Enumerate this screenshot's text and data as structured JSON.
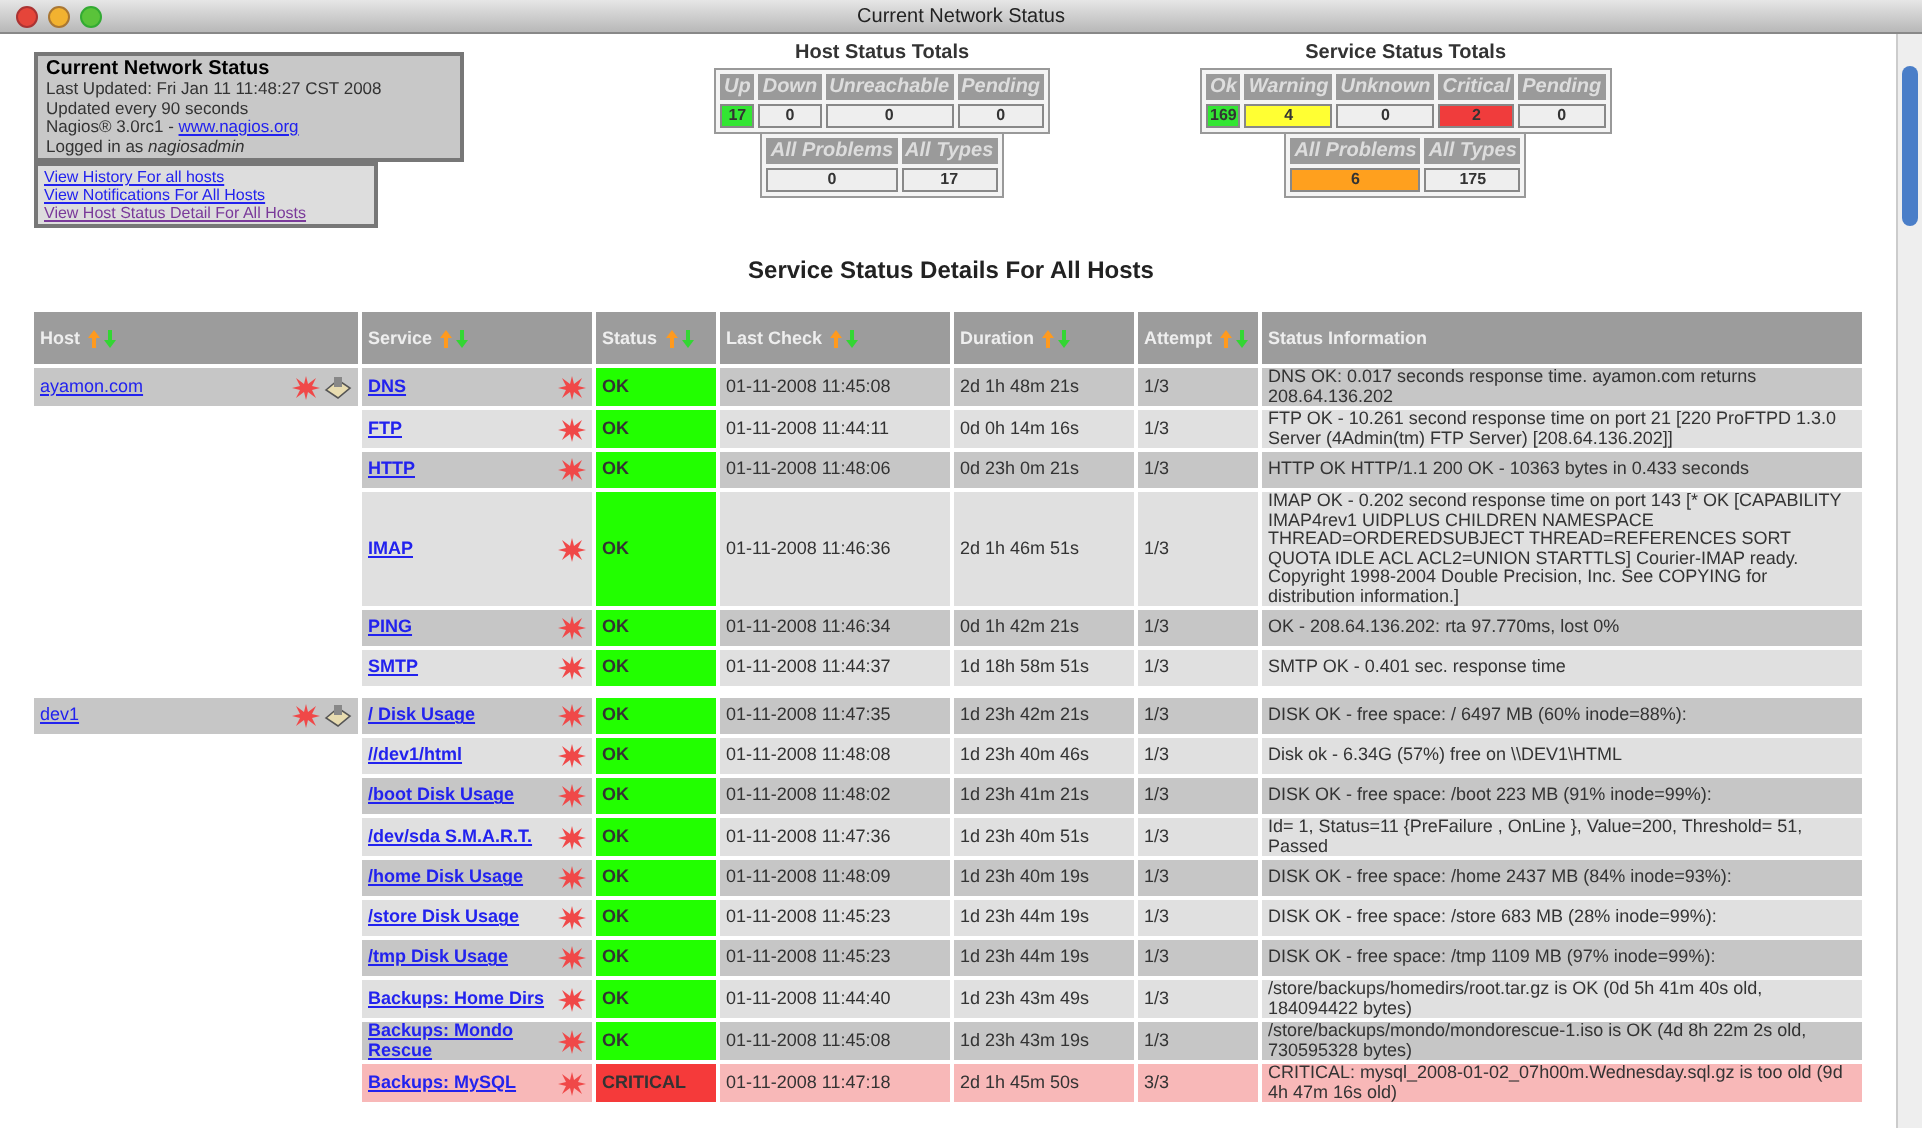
{
  "window": {
    "title": "Current Network Status"
  },
  "info_box": {
    "title": "Current Network Status",
    "lines": [
      "Last Updated: Fri Jan 11 11:48:27 CST 2008",
      "Updated every 90 seconds"
    ],
    "version": "Nagios® 3.0rc1 - ",
    "link": "www.nagios.org",
    "login": "Logged in as ",
    "user": "nagiosadmin"
  },
  "links": [
    "View History For all hosts",
    "View Notifications For All Hosts",
    "View Host Status Detail For All Hosts"
  ],
  "host_totals": {
    "title": "Host Status Totals",
    "cells": [
      {
        "label": "Up",
        "value": "17",
        "color": "#33e633"
      },
      {
        "label": "Down",
        "value": "0",
        "color": "#eeeeee"
      },
      {
        "label": "Unreachable",
        "value": "0",
        "color": "#eeeeee"
      },
      {
        "label": "Pending",
        "value": "0",
        "color": "#eeeeee"
      }
    ],
    "summary": [
      {
        "label": "All Problems",
        "value": "0",
        "color": "#eeeeee"
      },
      {
        "label": "All Types",
        "value": "17",
        "color": "#eeeeee"
      }
    ]
  },
  "service_totals": {
    "title": "Service Status Totals",
    "cells": [
      {
        "label": "Ok",
        "value": "169",
        "color": "#33e633"
      },
      {
        "label": "Warning",
        "value": "4",
        "color": "#ffff33"
      },
      {
        "label": "Unknown",
        "value": "0",
        "color": "#eeeeee"
      },
      {
        "label": "Critical",
        "value": "2",
        "color": "#f03c3c"
      },
      {
        "label": "Pending",
        "value": "0",
        "color": "#eeeeee"
      }
    ],
    "summary": [
      {
        "label": "All Problems",
        "value": "6",
        "color": "#ffa01e"
      },
      {
        "label": "All Types",
        "value": "175",
        "color": "#eeeeee"
      }
    ]
  },
  "heading": "Service Status Details For All Hosts",
  "columns": [
    {
      "label": "Host",
      "sortable": true
    },
    {
      "label": "Service",
      "sortable": true
    },
    {
      "label": "Status",
      "sortable": true
    },
    {
      "label": "Last Check",
      "sortable": true
    },
    {
      "label": "Duration",
      "sortable": true
    },
    {
      "label": "Attempt",
      "sortable": true
    },
    {
      "label": "Status Information",
      "sortable": false
    }
  ],
  "hosts": [
    {
      "name": "ayamon.com",
      "services": [
        {
          "name": "DNS",
          "status": "OK",
          "kind": "ok",
          "last_check": "01-11-2008 11:45:08",
          "duration": "2d 1h 48m 21s",
          "attempt": "1/3",
          "info": "DNS OK: 0.017 seconds response time. ayamon.com returns 208.64.136.202"
        },
        {
          "name": "FTP",
          "status": "OK",
          "kind": "ok",
          "last_check": "01-11-2008 11:44:11",
          "duration": "0d 0h 14m 16s",
          "attempt": "1/3",
          "info": "FTP OK - 10.261 second response time on port 21 [220 ProFTPD 1.3.0 Server (4Admin(tm) FTP Server) [208.64.136.202]]"
        },
        {
          "name": "HTTP",
          "status": "OK",
          "kind": "ok",
          "last_check": "01-11-2008 11:48:06",
          "duration": "0d 23h 0m 21s",
          "attempt": "1/3",
          "info": "HTTP OK HTTP/1.1 200 OK - 10363 bytes in 0.433 seconds"
        },
        {
          "name": "IMAP",
          "status": "OK",
          "kind": "ok",
          "last_check": "01-11-2008 11:46:36",
          "duration": "2d 1h 46m 51s",
          "attempt": "1/3",
          "info": "IMAP OK - 0.202 second response time on port 143 [* OK [CAPABILITY IMAP4rev1 UIDPLUS CHILDREN NAMESPACE THREAD=ORDEREDSUBJECT THREAD=REFERENCES SORT QUOTA IDLE ACL ACL2=UNION STARTTLS] Courier-IMAP ready. Copyright 1998-2004 Double Precision, Inc. See COPYING for distribution information.]"
        },
        {
          "name": "PING",
          "status": "OK",
          "kind": "ok",
          "last_check": "01-11-2008 11:46:34",
          "duration": "0d 1h 42m 21s",
          "attempt": "1/3",
          "info": "OK - 208.64.136.202: rta 97.770ms, lost 0%"
        },
        {
          "name": "SMTP",
          "status": "OK",
          "kind": "ok",
          "last_check": "01-11-2008 11:44:37",
          "duration": "1d 18h 58m 51s",
          "attempt": "1/3",
          "info": "SMTP OK - 0.401 sec. response time"
        }
      ]
    },
    {
      "name": "dev1",
      "services": [
        {
          "name": "/ Disk Usage",
          "status": "OK",
          "kind": "ok",
          "last_check": "01-11-2008 11:47:35",
          "duration": "1d 23h 42m 21s",
          "attempt": "1/3",
          "info": "DISK OK - free space: / 6497 MB (60% inode=88%):"
        },
        {
          "name": "//dev1/html",
          "status": "OK",
          "kind": "ok",
          "last_check": "01-11-2008 11:48:08",
          "duration": "1d 23h 40m 46s",
          "attempt": "1/3",
          "info": "Disk ok - 6.34G (57%) free on \\\\DEV1\\HTML"
        },
        {
          "name": "/boot Disk Usage",
          "status": "OK",
          "kind": "ok",
          "last_check": "01-11-2008 11:48:02",
          "duration": "1d 23h 41m 21s",
          "attempt": "1/3",
          "info": "DISK OK - free space: /boot 223 MB (91% inode=99%):"
        },
        {
          "name": "/dev/sda S.M.A.R.T.",
          "status": "OK",
          "kind": "ok",
          "last_check": "01-11-2008 11:47:36",
          "duration": "1d 23h 40m 51s",
          "attempt": "1/3",
          "info": "Id= 1, Status=11 {PreFailure , OnLine }, Value=200, Threshold= 51, Passed"
        },
        {
          "name": "/home Disk Usage",
          "status": "OK",
          "kind": "ok",
          "last_check": "01-11-2008 11:48:09",
          "duration": "1d 23h 40m 19s",
          "attempt": "1/3",
          "info": "DISK OK - free space: /home 2437 MB (84% inode=93%):"
        },
        {
          "name": "/store Disk Usage",
          "status": "OK",
          "kind": "ok",
          "last_check": "01-11-2008 11:45:23",
          "duration": "1d 23h 44m 19s",
          "attempt": "1/3",
          "info": "DISK OK - free space: /store 683 MB (28% inode=99%):"
        },
        {
          "name": "/tmp Disk Usage",
          "status": "OK",
          "kind": "ok",
          "last_check": "01-11-2008 11:45:23",
          "duration": "1d 23h 44m 19s",
          "attempt": "1/3",
          "info": "DISK OK - free space: /tmp 1109 MB (97% inode=99%):"
        },
        {
          "name": "Backups: Home Dirs",
          "status": "OK",
          "kind": "ok",
          "last_check": "01-11-2008 11:44:40",
          "duration": "1d 23h 43m 49s",
          "attempt": "1/3",
          "info": "/store/backups/homedirs/root.tar.gz is OK (0d 5h 41m 40s old, 184094422 bytes)"
        },
        {
          "name": "Backups: Mondo Rescue",
          "status": "OK",
          "kind": "ok",
          "last_check": "01-11-2008 11:45:08",
          "duration": "1d 23h 43m 19s",
          "attempt": "1/3",
          "info": "/store/backups/mondo/mondorescue-1.iso is OK (4d 8h 22m 2s old, 730595328 bytes)"
        },
        {
          "name": "Backups: MySQL",
          "status": "CRITICAL",
          "kind": "critical",
          "last_check": "01-11-2008 11:47:18",
          "duration": "2d 1h 45m 50s",
          "attempt": "3/3",
          "info": "CRITICAL: mysql_2008-01-02_07h00m.Wednesday.sql.gz is too old (9d 4h 47m 16s old)"
        }
      ]
    }
  ]
}
